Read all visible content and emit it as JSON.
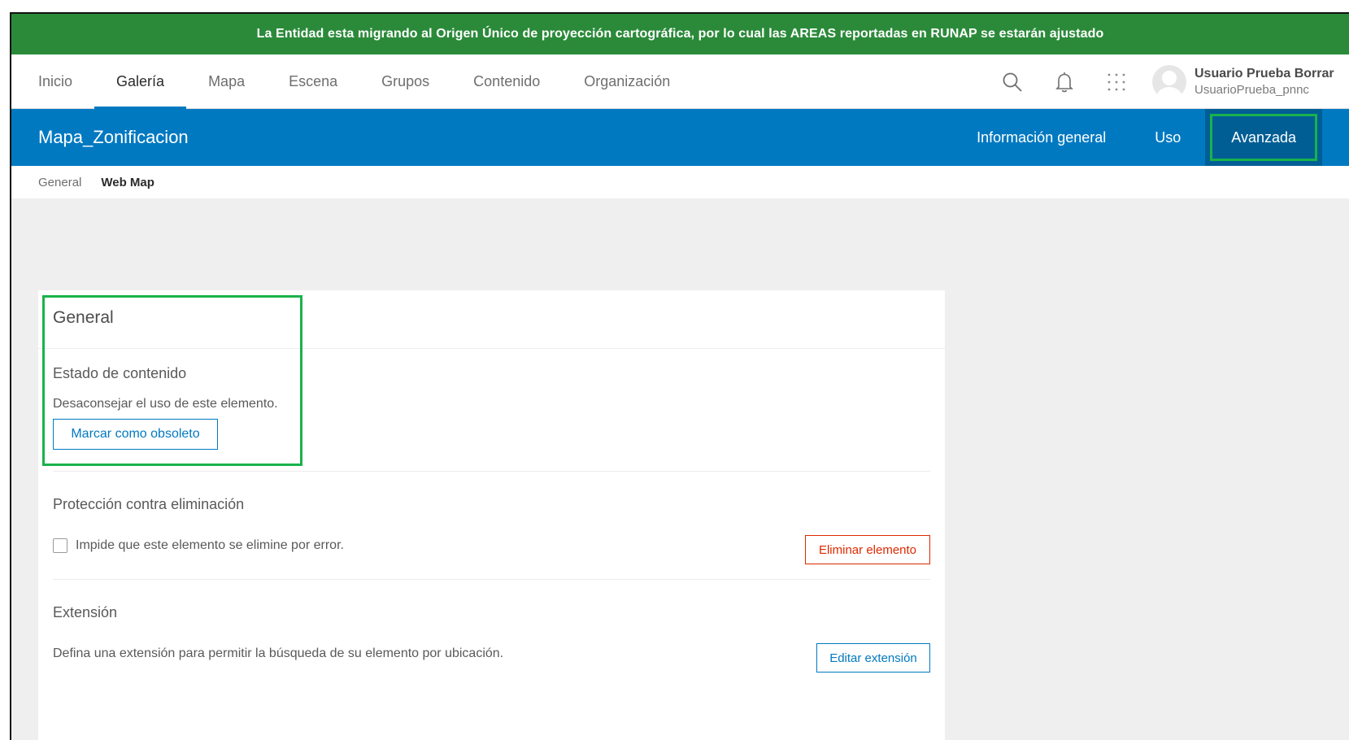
{
  "banner": {
    "text": "La Entidad esta migrando al Origen Único de proyección cartográfica, por lo cual las AREAS reportadas en RUNAP se estarán ajustado"
  },
  "nav": {
    "items": [
      {
        "label": "Inicio",
        "active": false
      },
      {
        "label": "Galería",
        "active": true
      },
      {
        "label": "Mapa",
        "active": false
      },
      {
        "label": "Escena",
        "active": false
      },
      {
        "label": "Grupos",
        "active": false
      },
      {
        "label": "Contenido",
        "active": false
      },
      {
        "label": "Organización",
        "active": false
      }
    ],
    "icons": [
      "search-icon",
      "bell-icon",
      "apps-grid-icon"
    ],
    "user": {
      "name": "Usuario Prueba Borrar",
      "username": "UsuarioPrueba_pnnc"
    }
  },
  "item": {
    "title": "Mapa_Zonificacion",
    "tabs": [
      {
        "label": "Información general",
        "active": false
      },
      {
        "label": "Uso",
        "active": false
      },
      {
        "label": "Avanzada",
        "active": true
      }
    ]
  },
  "breadcrumb": {
    "parent": "General",
    "current": "Web Map"
  },
  "general": {
    "heading": "General",
    "status": {
      "label": "Estado de contenido",
      "description": "Desaconsejar el uso de este elemento.",
      "button": "Marcar como obsoleto"
    },
    "protection": {
      "label": "Protección contra eliminación",
      "checkbox_label": "Impide que este elemento se elimine por error.",
      "checked": false,
      "delete_button": "Eliminar elemento"
    },
    "extent": {
      "label": "Extensión",
      "description": "Defina una extensión para permitir la búsqueda de su elemento por ubicación.",
      "button": "Editar extensión"
    }
  },
  "colors": {
    "banner": "#2b8a3a",
    "brand_blue": "#0079c1",
    "active_tab": "#005e95",
    "highlight_green": "#19b24b",
    "danger": "#de2900"
  }
}
